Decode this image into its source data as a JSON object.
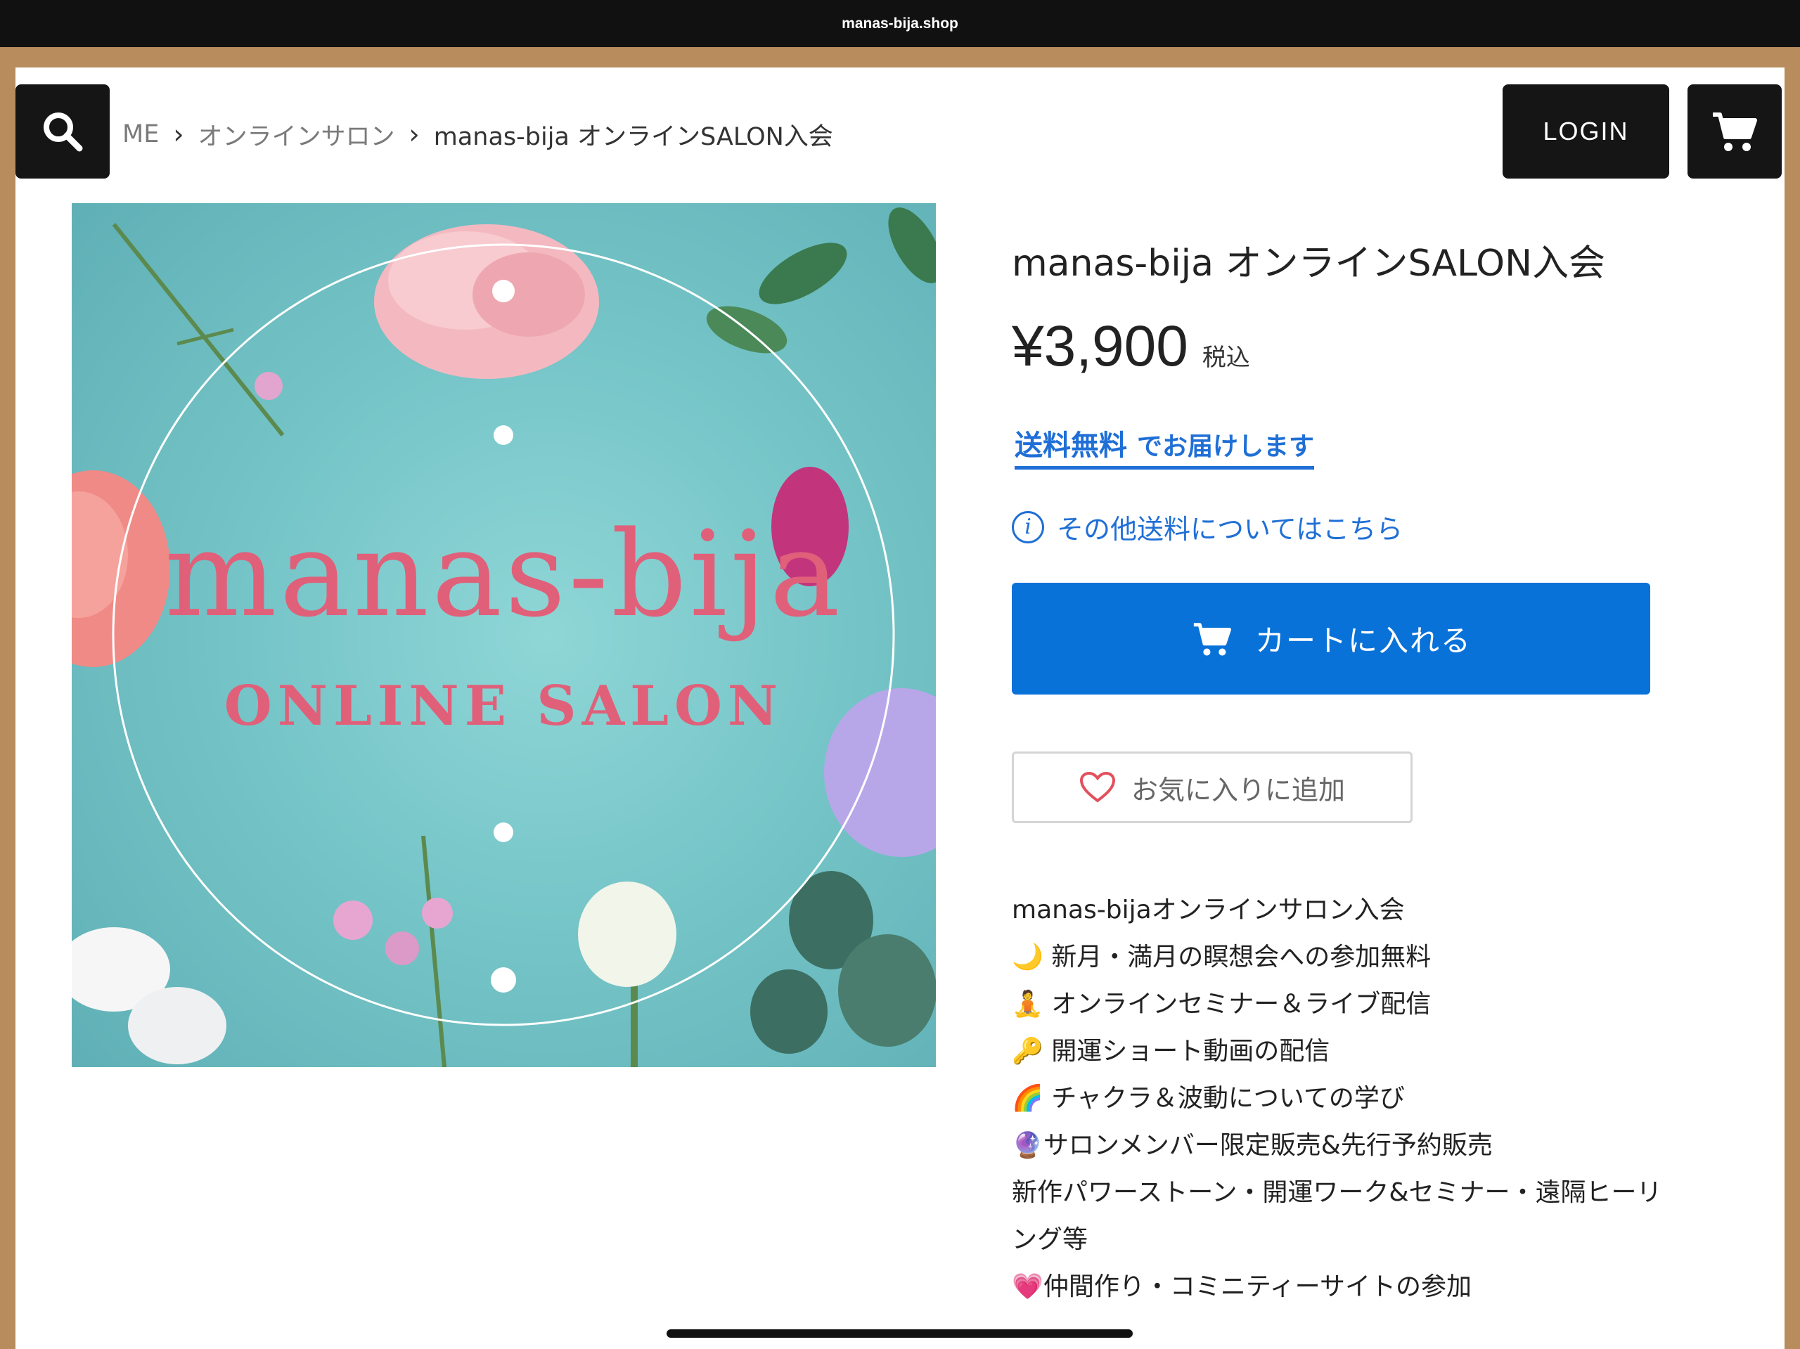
{
  "browser": {
    "url": "manas-bija.shop"
  },
  "header": {
    "login_label": "LOGIN"
  },
  "breadcrumb": {
    "home": "ME",
    "category": "オンラインサロン",
    "current": "manas-bija オンラインSALON入会"
  },
  "image": {
    "brand": "manas-bija",
    "subtitle": "ONLINE SALON"
  },
  "product": {
    "title": "manas-bija オンラインSALON入会",
    "price": "¥3,900",
    "tax_label": "税込",
    "shipping_main": "送料無料",
    "shipping_sub": "でお届けします",
    "shipping_info_link": "その他送料についてはこちら",
    "add_to_cart": "カートに入れる",
    "add_to_favorites": "お気に入りに追加"
  },
  "description": [
    "manas-bijaオンラインサロン入会",
    "🌙 新月・満月の瞑想会への参加無料",
    "🧘 オンラインセミナー＆ライブ配信",
    "🔑 開運ショート動画の配信",
    "🌈 チャクラ＆波動についての学び",
    "🔮サロンメンバー限定販売&先行予約販売",
    "新作パワーストーン・開運ワーク&セミナー・遠隔ヒーリ",
    "ング等",
    "💗仲間作り・コミニティーサイトの参加"
  ],
  "colors": {
    "accent": "#0872d9",
    "brand_pink": "#e0607a",
    "dark": "#151515"
  }
}
